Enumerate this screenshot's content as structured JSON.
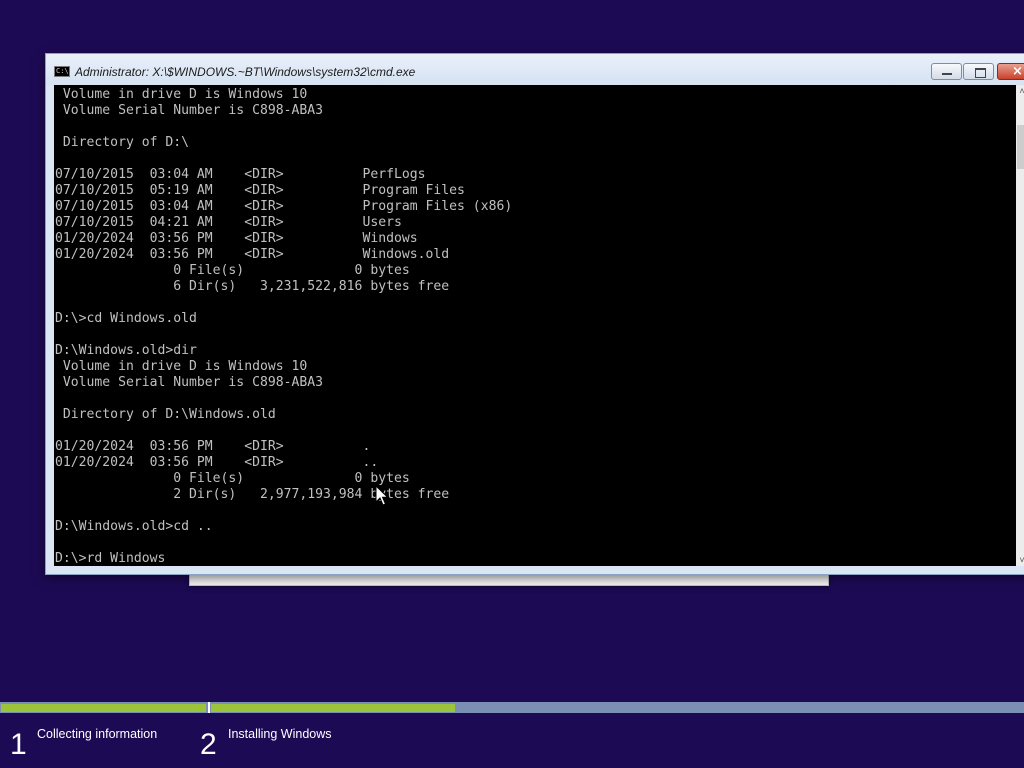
{
  "window": {
    "title": "Administrator: X:\\$WINDOWS.~BT\\Windows\\system32\\cmd.exe",
    "icon_text": "C:\\",
    "buttons": [
      "minimize",
      "maximize",
      "close"
    ]
  },
  "console_lines": [
    " Volume in drive D is Windows 10",
    " Volume Serial Number is C898-ABA3",
    "",
    " Directory of D:\\",
    "",
    "07/10/2015  03:04 AM    <DIR>          PerfLogs",
    "07/10/2015  05:19 AM    <DIR>          Program Files",
    "07/10/2015  03:04 AM    <DIR>          Program Files (x86)",
    "07/10/2015  04:21 AM    <DIR>          Users",
    "01/20/2024  03:56 PM    <DIR>          Windows",
    "01/20/2024  03:56 PM    <DIR>          Windows.old",
    "               0 File(s)              0 bytes",
    "               6 Dir(s)   3,231,522,816 bytes free",
    "",
    "D:\\>cd Windows.old",
    "",
    "D:\\Windows.old>dir",
    " Volume in drive D is Windows 10",
    " Volume Serial Number is C898-ABA3",
    "",
    " Directory of D:\\Windows.old",
    "",
    "01/20/2024  03:56 PM    <DIR>          .",
    "01/20/2024  03:56 PM    <DIR>          ..",
    "               0 File(s)              0 bytes",
    "               2 Dir(s)   2,977,193,984 bytes free",
    "",
    "D:\\Windows.old>cd ..",
    "",
    "D:\\>rd Windows"
  ],
  "setup_progress": {
    "steps": [
      {
        "number": "1",
        "label": "Collecting information",
        "progress": 1.0
      },
      {
        "number": "2",
        "label": "Installing Windows",
        "progress": 0.3
      }
    ]
  },
  "icons": {
    "app": "cmd-icon",
    "cursor": "mouse-pointer-icon"
  }
}
